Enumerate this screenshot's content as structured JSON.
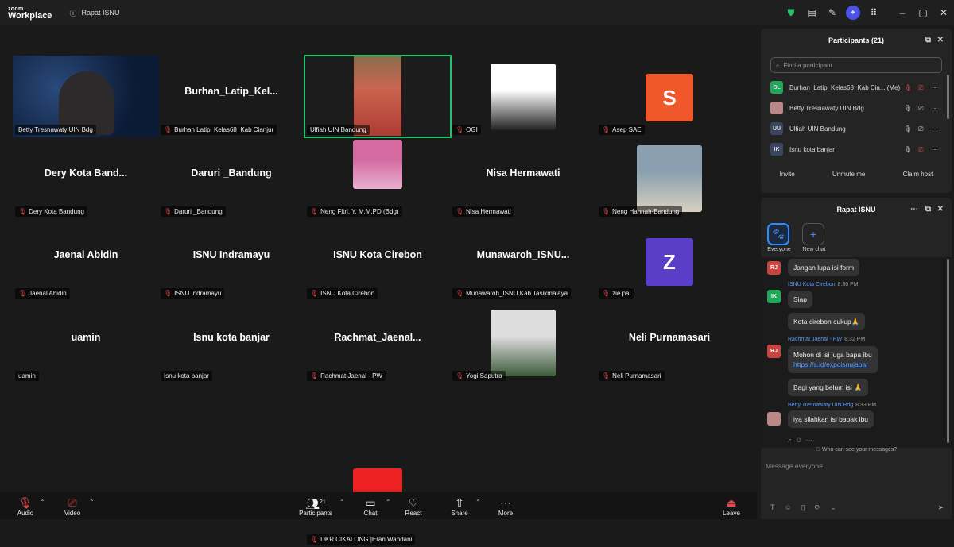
{
  "titlebar": {
    "brand_line1": "zoom",
    "brand_line2": "Workplace",
    "meeting_title": "Rapat ISNU"
  },
  "tiles": [
    {
      "id": "betty",
      "display": "",
      "label": "Betty Tresnawaty UIN Bdg",
      "mic_muted": false,
      "kind": "video"
    },
    {
      "id": "burhan",
      "display": "Burhan_Latip_Kel...",
      "label": "Burhan Latip_Kelas68_Kab Cianjur",
      "mic_muted": true,
      "kind": "name"
    },
    {
      "id": "ulfiah",
      "display": "",
      "label": "Ulfiah UIN Bandung",
      "mic_muted": false,
      "kind": "video",
      "active": true
    },
    {
      "id": "ogi",
      "display": "",
      "label": "OGI",
      "mic_muted": true,
      "kind": "photo"
    },
    {
      "id": "asep",
      "display": "S",
      "label": "Asep SAE",
      "mic_muted": true,
      "kind": "avatar",
      "color": "#f0582c"
    },
    {
      "id": "dery",
      "display": "Dery Kota Band...",
      "label": "Dery Kota Bandung",
      "mic_muted": true,
      "kind": "name"
    },
    {
      "id": "daruri",
      "display": "Daruri _Bandung",
      "label": "Daruri _Bandung",
      "mic_muted": true,
      "kind": "name"
    },
    {
      "id": "neng_fitri",
      "display": "",
      "label": "Neng Fitri. Y. M.M.PD (Bdg)",
      "mic_muted": true,
      "kind": "photo"
    },
    {
      "id": "nisa",
      "display": "Nisa Hermawati",
      "label": "Nisa Hermawati",
      "mic_muted": true,
      "kind": "name"
    },
    {
      "id": "neng_hannah",
      "display": "",
      "label": "Neng Hannah-Bandung",
      "mic_muted": true,
      "kind": "photo"
    },
    {
      "id": "jaenal",
      "display": "Jaenal Abidin",
      "label": "Jaenal Abidin",
      "mic_muted": true,
      "kind": "name"
    },
    {
      "id": "isnu_indramayu",
      "display": "ISNU Indramayu",
      "label": "ISNU Indramayu",
      "mic_muted": true,
      "kind": "name"
    },
    {
      "id": "isnu_cirebon",
      "display": "ISNU Kota Cirebon",
      "label": "ISNU Kota Cirebon",
      "mic_muted": true,
      "kind": "name"
    },
    {
      "id": "munawaroh",
      "display": "Munawaroh_ISNU...",
      "label": "Munawaroh_ISNU Kab Tasikmalaya",
      "mic_muted": true,
      "kind": "name"
    },
    {
      "id": "zie",
      "display": "Z",
      "label": "zie pai",
      "mic_muted": true,
      "kind": "avatar",
      "color": "#5b3ec8"
    },
    {
      "id": "uamin",
      "display": "uamin",
      "label": "uamin",
      "mic_muted": false,
      "kind": "name"
    },
    {
      "id": "isnu_banjar",
      "display": "Isnu kota banjar",
      "label": "Isnu kota banjar",
      "mic_muted": false,
      "kind": "name"
    },
    {
      "id": "rachmat",
      "display": "Rachmat_Jaenal...",
      "label": "Rachmat Jaenal - PW",
      "mic_muted": true,
      "kind": "name"
    },
    {
      "id": "yogi",
      "display": "",
      "label": "Yogi Saputra",
      "mic_muted": true,
      "kind": "photo"
    },
    {
      "id": "neli",
      "display": "Neli Purnamasari",
      "label": "Neli Purnamasari",
      "mic_muted": true,
      "kind": "name"
    },
    {
      "id": "dkr",
      "display": "",
      "label": "DKR CIKALONG |Eran Wandani",
      "mic_muted": true,
      "kind": "photo"
    }
  ],
  "toolbar": {
    "audio": "Audio",
    "video": "Video",
    "participants": "Participants",
    "participants_count": "21",
    "chat": "Chat",
    "react": "React",
    "share": "Share",
    "more": "More",
    "leave": "Leave"
  },
  "participants_panel": {
    "title": "Participants (21)",
    "search_placeholder": "Find a participant",
    "rows": [
      {
        "initials": "BL",
        "name": "Burhan_Latip_Kelas68_Kab Cia... (Me)",
        "color": "#1fa85a",
        "mic_muted": true,
        "cam_off": true
      },
      {
        "initials": "",
        "name": "Betty Tresnawaty UIN Bdg",
        "color": "#b88",
        "mic_muted": false,
        "cam_off": false
      },
      {
        "initials": "UU",
        "name": "Ulfiah UIN Bandung",
        "color": "#3a4560",
        "mic_muted": false,
        "cam_off": false
      },
      {
        "initials": "IK",
        "name": "Isnu kota banjar",
        "color": "#3a4560",
        "mic_muted": false,
        "cam_off": true
      }
    ],
    "invite": "Invite",
    "unmute": "Unmute me",
    "claim_host": "Claim host"
  },
  "chat_panel": {
    "title": "Rapat ISNU",
    "tab_everyone": "Everyone",
    "tab_new_chat": "New chat",
    "messages": [
      {
        "type": "bubble",
        "initials": "RJ",
        "color": "#c9433f",
        "text": "Jangan lupa isi form"
      },
      {
        "type": "header",
        "initials": "IK",
        "color": "#1fa85a",
        "sender": "ISNU Kota Cirebon",
        "time": "8:30 PM"
      },
      {
        "type": "bubble",
        "text": "Siap"
      },
      {
        "type": "bubble",
        "text": "Kota cirebon cukup🙏"
      },
      {
        "type": "header",
        "initials": "RJ",
        "color": "#c9433f",
        "sender": "Rachmat Jaenal - PW",
        "time": "8:32 PM"
      },
      {
        "type": "bubble",
        "text": "Mohon di isi juga bapa ibu",
        "link": "https://s.id/expoisnujabar"
      },
      {
        "type": "bubble",
        "text": "Bagi yang belum isi 🙏"
      },
      {
        "type": "header",
        "initials": "",
        "color": "#b88",
        "sender": "Betty Tresnawaty UIN Bdg",
        "time": "8:33 PM"
      },
      {
        "type": "bubble",
        "text": "iya silahkan isi bapak ibu"
      }
    ],
    "who_can_see": "Who can see your messages?",
    "input_placeholder": "Message everyone"
  }
}
